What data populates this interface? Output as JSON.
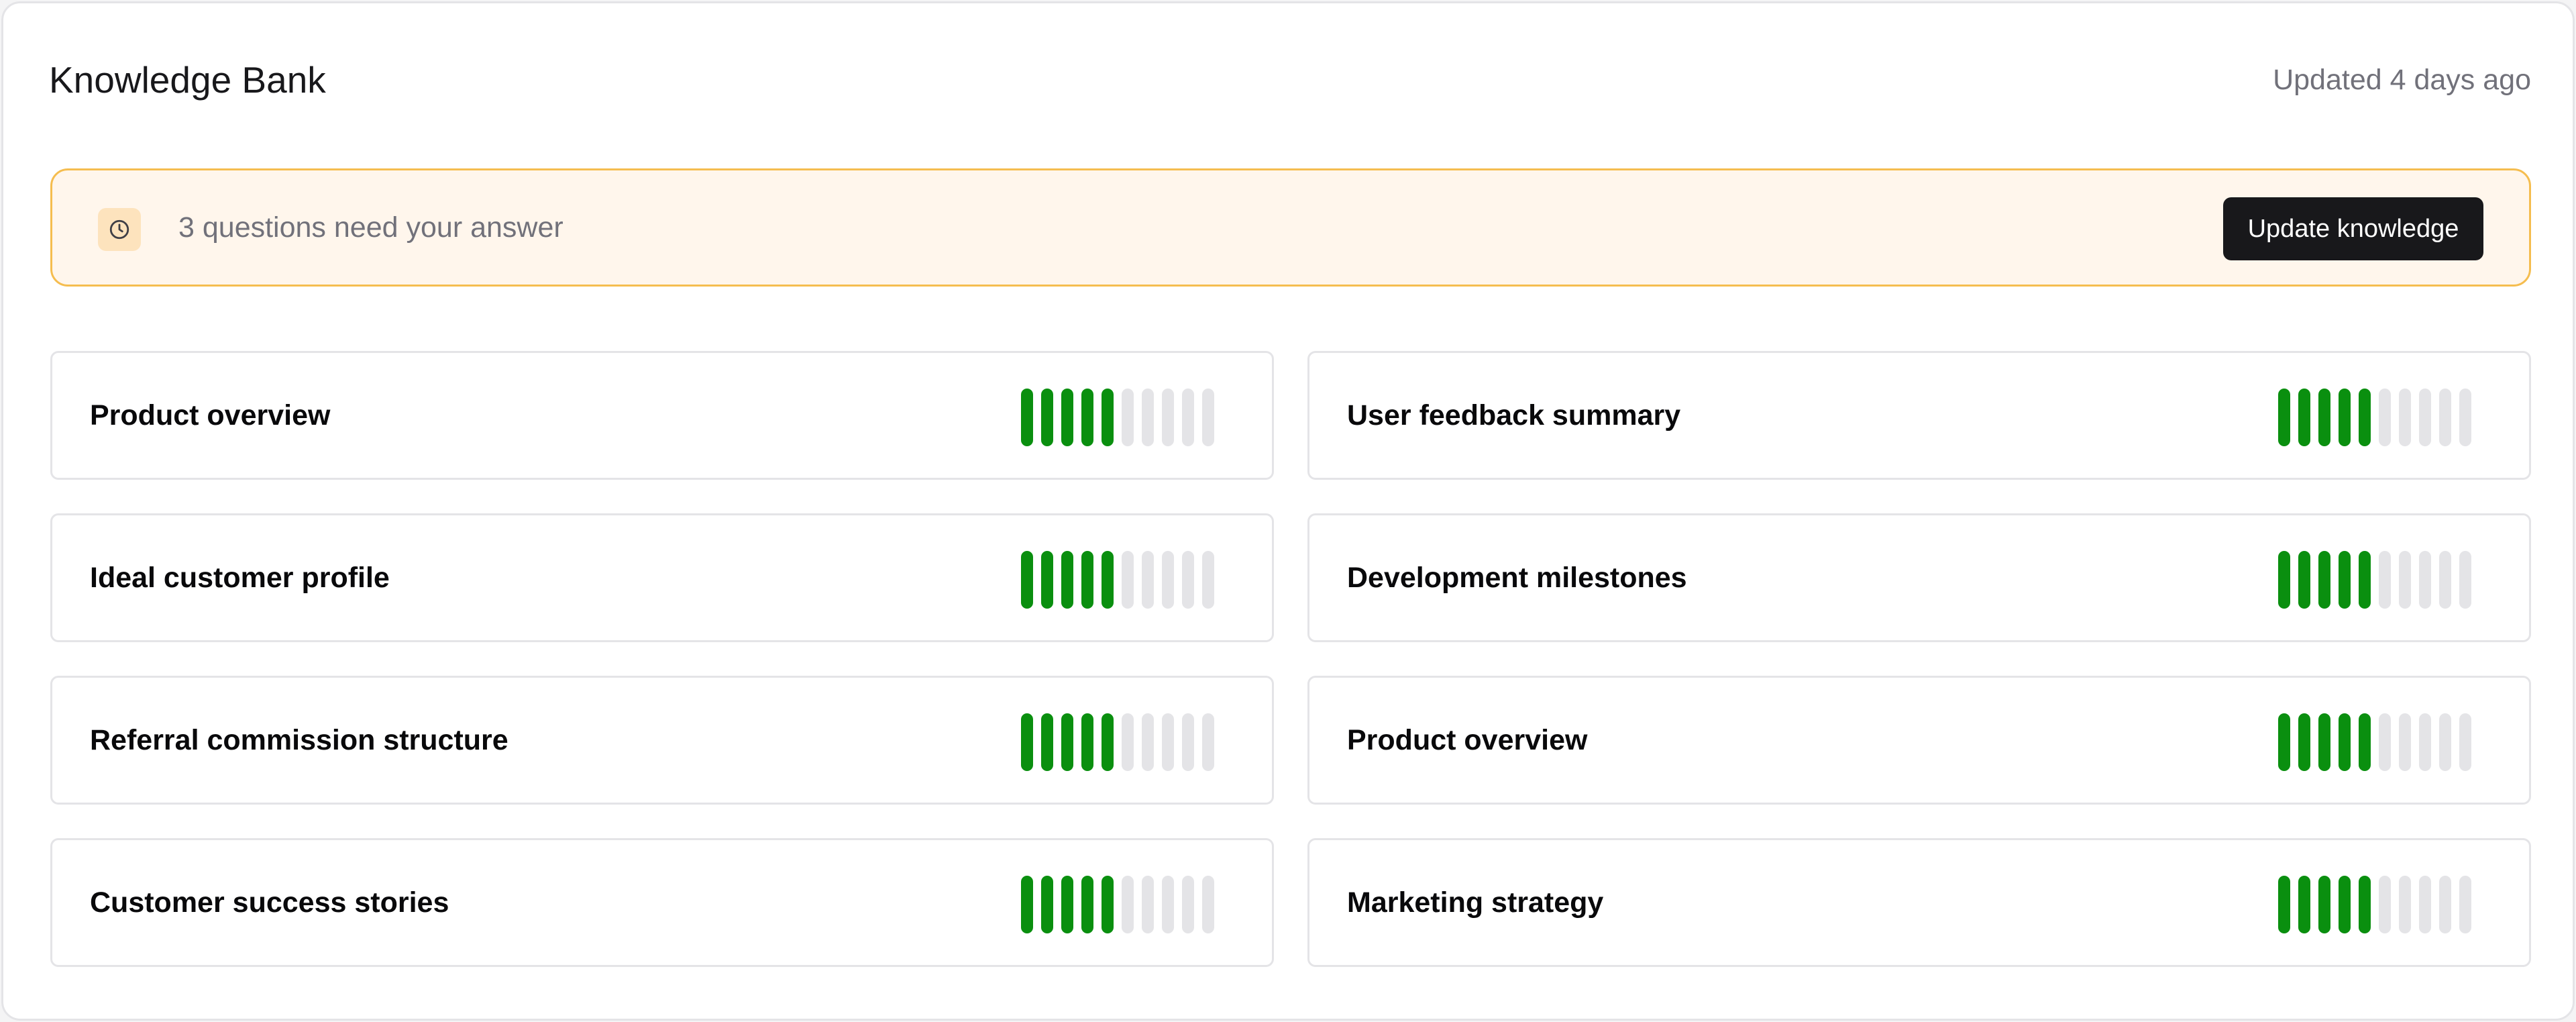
{
  "header": {
    "title": "Knowledge Bank",
    "updated": "Updated 4 days ago"
  },
  "banner": {
    "icon": "clock-icon",
    "message": "3 questions need your answer",
    "button_label": "Update knowledge"
  },
  "colors": {
    "meter_filled": "#0a8f0f",
    "meter_empty": "#e4e4e7",
    "banner_bg": "#fff6ec",
    "banner_border": "#f5bd4f",
    "button_bg": "#18181b"
  },
  "meter_segments_total": 10,
  "items": [
    {
      "label": "Product overview",
      "filled": 5
    },
    {
      "label": "User feedback summary",
      "filled": 5
    },
    {
      "label": "Ideal customer profile",
      "filled": 5
    },
    {
      "label": "Development milestones",
      "filled": 5
    },
    {
      "label": "Referral commission structure",
      "filled": 5
    },
    {
      "label": "Product overview",
      "filled": 5
    },
    {
      "label": "Customer success stories",
      "filled": 5
    },
    {
      "label": "Marketing strategy",
      "filled": 5
    }
  ]
}
